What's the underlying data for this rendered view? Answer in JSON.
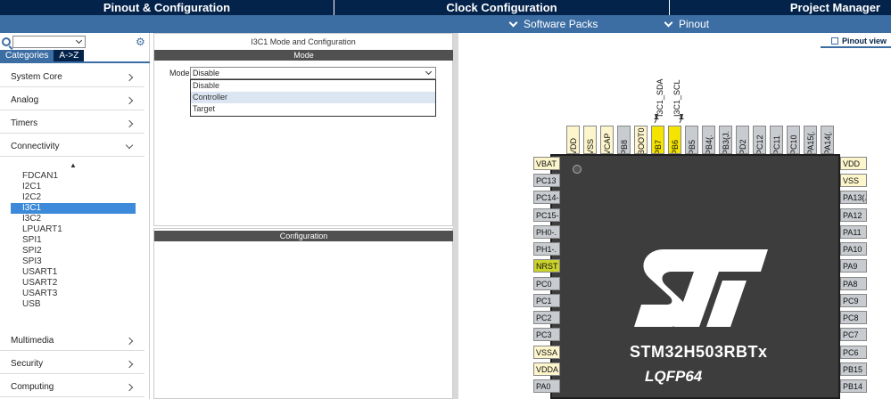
{
  "top_tabs": {
    "pinout": "Pinout & Configuration",
    "clock": "Clock Configuration",
    "project": "Project Manager"
  },
  "sub_menu": {
    "software_packs": "Software Packs",
    "pinout": "Pinout"
  },
  "sidebar": {
    "search_value": "",
    "tab_categories": "Categories",
    "tab_az": "A->Z",
    "categories": [
      {
        "label": "System Core"
      },
      {
        "label": "Analog"
      },
      {
        "label": "Timers"
      },
      {
        "label": "Connectivity"
      },
      {
        "label": "Multimedia"
      },
      {
        "label": "Security"
      },
      {
        "label": "Computing"
      }
    ],
    "connectivity_items": [
      "FDCAN1",
      "I2C1",
      "I2C2",
      "I3C1",
      "I3C2",
      "LPUART1",
      "SPI1",
      "SPI2",
      "SPI3",
      "USART1",
      "USART2",
      "USART3",
      "USB"
    ],
    "selected_item": "I3C1"
  },
  "config_panel": {
    "title": "I3C1 Mode and Configuration",
    "mode_header": "Mode",
    "mode_label": "Mode",
    "mode_value": "Disable",
    "mode_options": [
      "Disable",
      "Controller",
      "Target"
    ],
    "highlighted_option": "Controller",
    "config_header": "Configuration"
  },
  "pinout_view": {
    "view_tab": "Pinout view",
    "part_name": "STM32H503RBTx",
    "package": "LQFP64",
    "signal_labels": [
      "I3C1_SDA",
      "I3C1_SCL"
    ],
    "top_pins": [
      "VDD",
      "VSS",
      "VCAP",
      "PB8",
      "BOOT0",
      "PB7",
      "PB6",
      "PB5",
      "PB4(.",
      "PB3(J.",
      "PD2",
      "PC12",
      "PC11",
      "PC10",
      "PA15(.",
      "PA14(."
    ],
    "left_pins": [
      "VBAT",
      "PC13",
      "PC14-.",
      "PC15-.",
      "PH0-.",
      "PH1-.",
      "NRST",
      "PC0",
      "PC1",
      "PC2",
      "PC3",
      "VSSA",
      "VDDA",
      "PA0"
    ],
    "right_pins": [
      "VDD",
      "VSS",
      "PA13(.",
      "PA12",
      "PA11",
      "PA10",
      "PA9",
      "PA8",
      "PC9",
      "PC8",
      "PC7",
      "PC6",
      "PB15",
      "PB14"
    ],
    "colors": {
      "gray_pin": "#c8ccd0",
      "power_pin": "#fdf5cb",
      "reset_pin": "#cbd32b",
      "assigned_pin": "#f5e400",
      "chip_body": "#3d3d3d"
    }
  }
}
